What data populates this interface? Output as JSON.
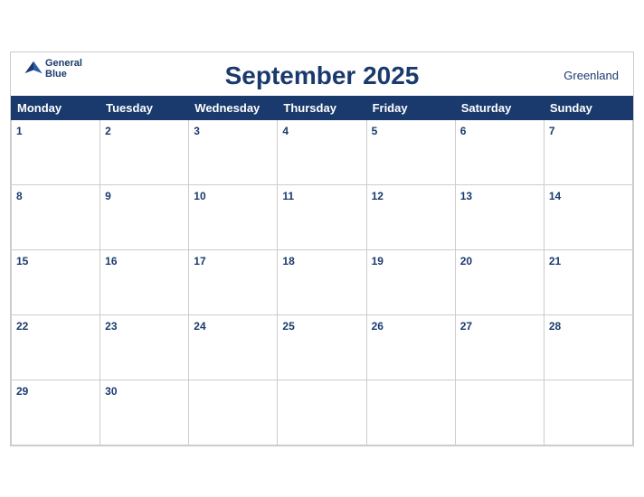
{
  "header": {
    "title": "September 2025",
    "region": "Greenland",
    "logo_general": "General",
    "logo_blue": "Blue"
  },
  "weekdays": [
    "Monday",
    "Tuesday",
    "Wednesday",
    "Thursday",
    "Friday",
    "Saturday",
    "Sunday"
  ],
  "weeks": [
    [
      1,
      2,
      3,
      4,
      5,
      6,
      7
    ],
    [
      8,
      9,
      10,
      11,
      12,
      13,
      14
    ],
    [
      15,
      16,
      17,
      18,
      19,
      20,
      21
    ],
    [
      22,
      23,
      24,
      25,
      26,
      27,
      28
    ],
    [
      29,
      30,
      null,
      null,
      null,
      null,
      null
    ]
  ],
  "accent_color": "#1a3a6e"
}
